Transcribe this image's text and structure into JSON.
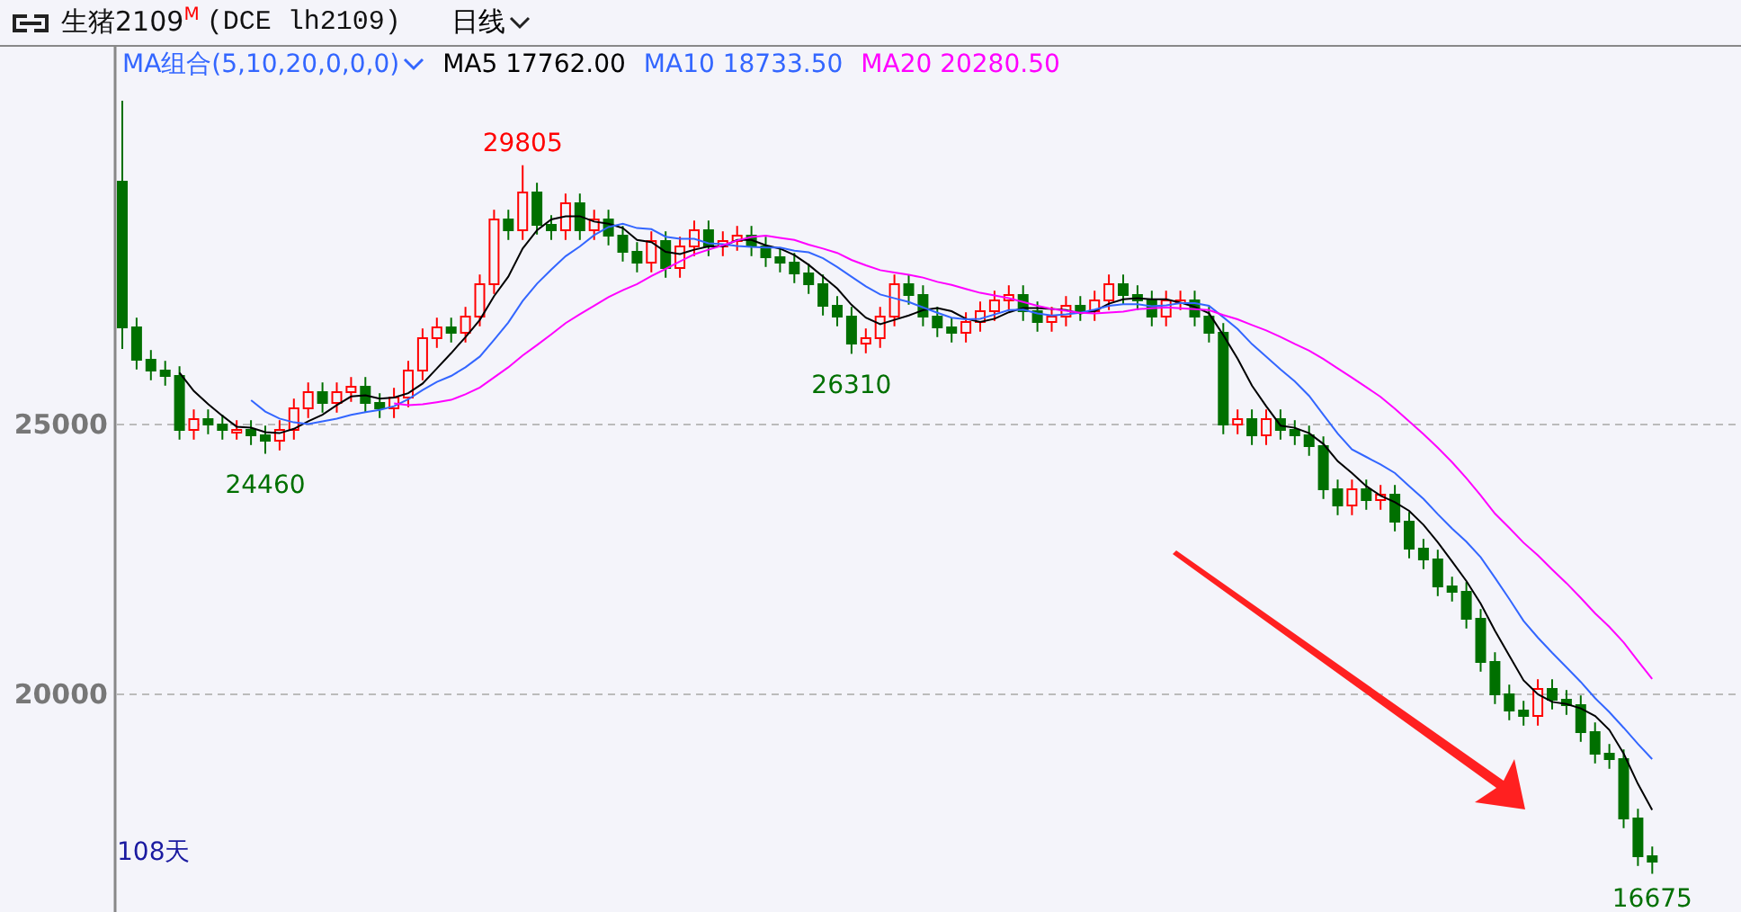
{
  "header": {
    "title": "生猪2109",
    "title_mark": "M",
    "code": "(DCE lh2109)",
    "period": "日线"
  },
  "legend": {
    "group": "MA组合(5,10,20,0,0,0)",
    "items": [
      {
        "label": "MA5 17762.00",
        "color": "#000000"
      },
      {
        "label": "MA10 18733.50",
        "color": "#3366ff"
      },
      {
        "label": "MA20 20280.50",
        "color": "#ff00ff"
      }
    ]
  },
  "chart": {
    "y_axis_labels": [
      "25000",
      "20000"
    ],
    "price_labels": [
      {
        "text": "29805",
        "kind": "high"
      },
      {
        "text": "24460",
        "kind": "low"
      },
      {
        "text": "26310",
        "kind": "low"
      },
      {
        "text": "16675",
        "kind": "low"
      }
    ],
    "days": "108天"
  }
}
